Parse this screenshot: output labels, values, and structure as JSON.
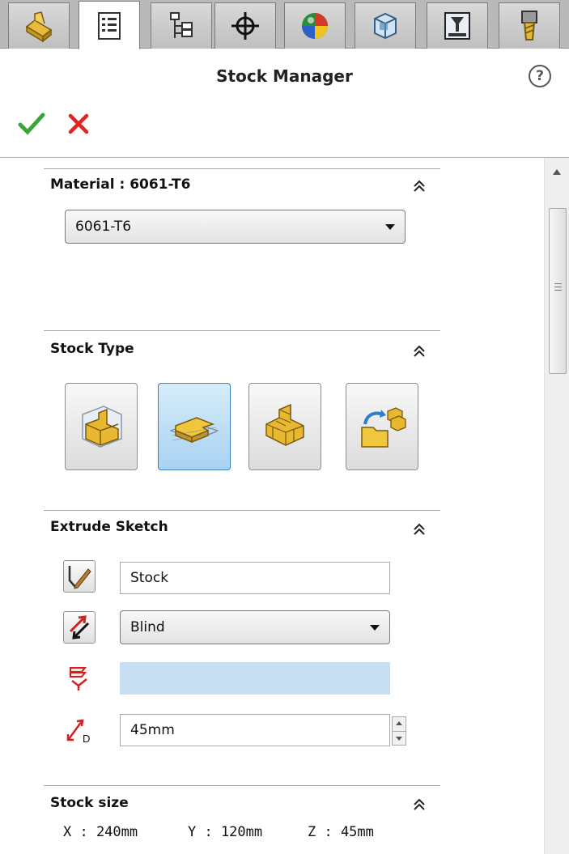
{
  "tabs": [
    {
      "icon": "feature-manager-icon"
    },
    {
      "icon": "property-manager-icon",
      "active": true
    },
    {
      "icon": "configuration-manager-icon"
    },
    {
      "icon": "dimxpert-icon"
    },
    {
      "icon": "display-manager-icon"
    },
    {
      "icon": "camworks-feature-tree-icon"
    },
    {
      "icon": "camworks-operation-tree-icon"
    },
    {
      "icon": "camworks-tool-tree-icon"
    }
  ],
  "header": {
    "title": "Stock Manager",
    "help_icon": "?"
  },
  "actions": {
    "ok_icon": "check-icon",
    "cancel_icon": "close-icon"
  },
  "material": {
    "title": "Material : 6061-T6",
    "selected": "6061-T6"
  },
  "stock_type": {
    "title": "Stock Type",
    "options": [
      {
        "icon": "bounding-box-stock-icon"
      },
      {
        "icon": "extrude-sketch-stock-icon",
        "active": true
      },
      {
        "icon": "stl-file-stock-icon"
      },
      {
        "icon": "part-file-stock-icon"
      }
    ]
  },
  "extrude_sketch": {
    "title": "Extrude Sketch",
    "sketch_value": "Stock",
    "end_condition": "Blind",
    "direction_value": "",
    "depth_value": "45mm"
  },
  "stock_size": {
    "title": "Stock size",
    "x": "X : 240mm",
    "y": "Y : 120mm",
    "z": "Z : 45mm"
  },
  "colors": {
    "accent_blue": "#3b83c0",
    "ok_green": "#3aa63a",
    "cancel_red": "#e02424",
    "gold": "#e8b830"
  }
}
